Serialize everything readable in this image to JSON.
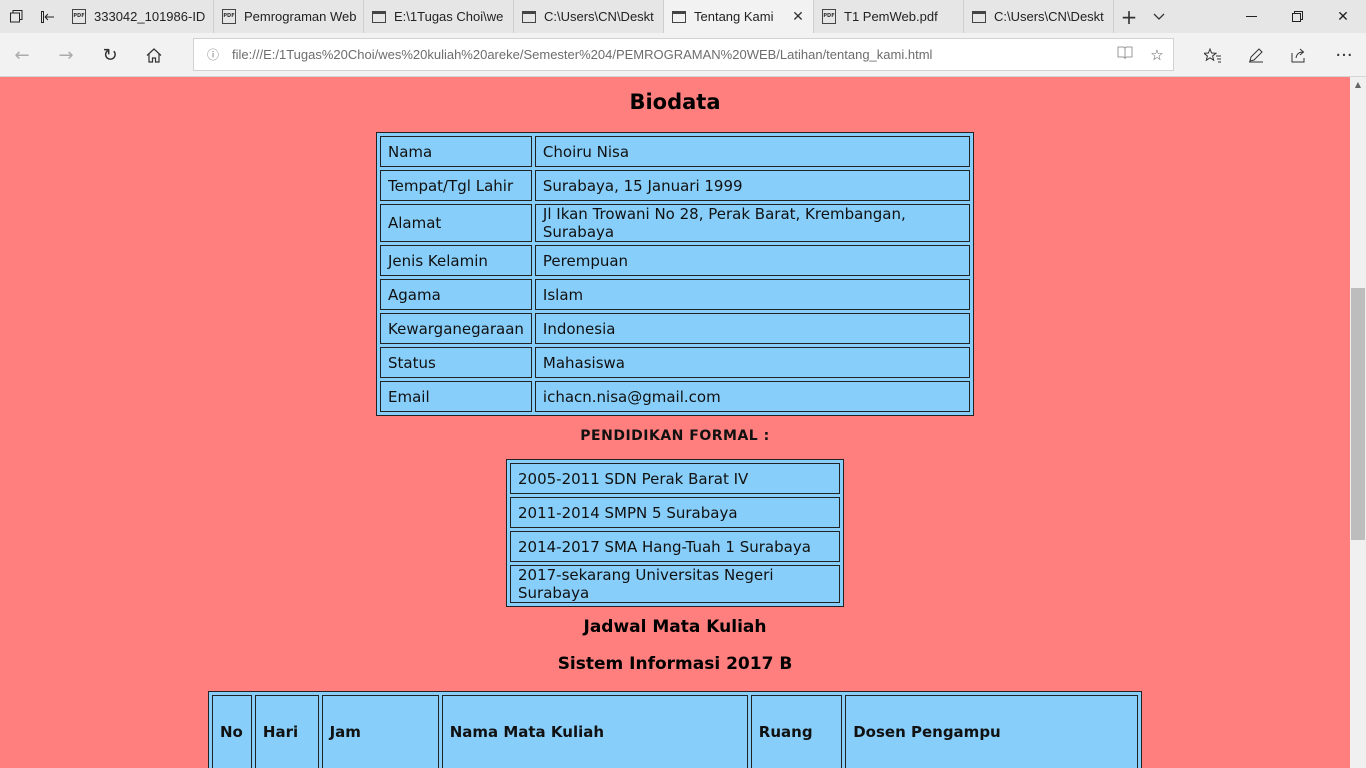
{
  "browser": {
    "tabs": [
      {
        "label": "333042_101986-ID",
        "icon": "pdf-icon"
      },
      {
        "label": "Pemrograman Web",
        "icon": "pdf-icon"
      },
      {
        "label": "E:\\1Tugas Choi\\we",
        "icon": "page-icon"
      },
      {
        "label": "C:\\Users\\CN\\Deskt",
        "icon": "page-icon"
      },
      {
        "label": "Tentang Kami",
        "icon": "page-icon",
        "active": true
      },
      {
        "label": "T1 PemWeb.pdf",
        "icon": "pdf-icon"
      },
      {
        "label": "C:\\Users\\CN\\Deskt",
        "icon": "page-icon"
      }
    ],
    "url": "file:///E:/1Tugas%20Choi/wes%20kuliah%20areke/Semester%204/PEMROGRAMAN%20WEB/Latihan/tentang_kami.html"
  },
  "page": {
    "title": "Biodata",
    "biodata": [
      {
        "label": "Nama",
        "value": "Choiru Nisa"
      },
      {
        "label": "Tempat/Tgl Lahir",
        "value": "Surabaya, 15 Januari 1999"
      },
      {
        "label": "Alamat",
        "value": "Jl Ikan Trowani No 28, Perak Barat, Krembangan, Surabaya"
      },
      {
        "label": "Jenis Kelamin",
        "value": "Perempuan"
      },
      {
        "label": "Agama",
        "value": "Islam"
      },
      {
        "label": "Kewarganegaraan",
        "value": "Indonesia"
      },
      {
        "label": "Status",
        "value": "Mahasiswa"
      },
      {
        "label": "Email",
        "value": "ichacn.nisa@gmail.com"
      }
    ],
    "pendidikan_title": "PENDIDIKAN FORMAL :",
    "pendidikan": [
      "2005-2011 SDN Perak Barat IV",
      "2011-2014 SMPN 5 Surabaya",
      "2014-2017 SMA Hang-Tuah 1 Surabaya",
      "2017-sekarang Universitas Negeri Surabaya"
    ],
    "jadwal_title": "Jadwal Mata Kuliah",
    "kelas_title": "Sistem Informasi 2017 B",
    "jadwal_headers": [
      "No",
      "Hari",
      "Jam",
      "Nama Mata Kuliah",
      "Ruang",
      "Dosen Pengampu"
    ]
  },
  "colors": {
    "page_background": "#ff7f7f",
    "table_background": "#87cefa"
  }
}
